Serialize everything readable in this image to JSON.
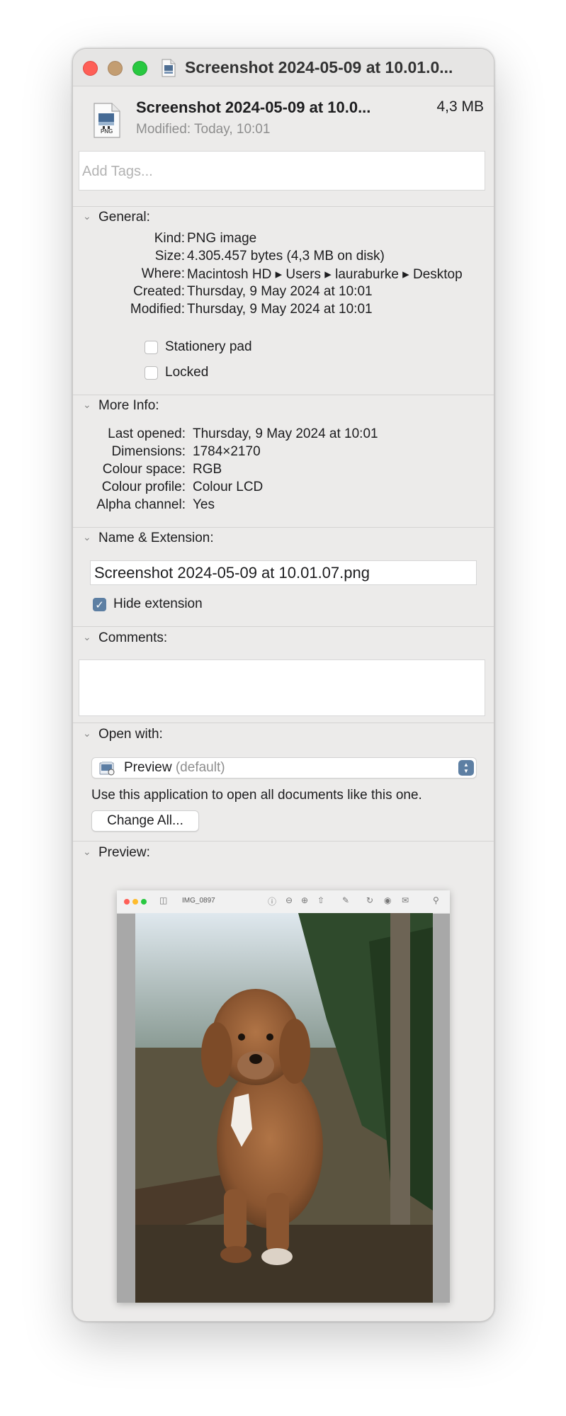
{
  "window": {
    "title": "Screenshot 2024-05-09 at 10.01.0...",
    "traffic_lights": [
      "close",
      "minimize",
      "zoom"
    ]
  },
  "header": {
    "file_name": "Screenshot 2024-05-09 at 10.0...",
    "file_size": "4,3 MB",
    "modified": "Modified: Today, 10:01",
    "file_icon": "png-file-icon",
    "file_icon_badge": "PNG"
  },
  "tags": {
    "placeholder": "Add Tags..."
  },
  "general": {
    "heading": "General:",
    "rows": [
      {
        "label": "Kind:",
        "value": "PNG image"
      },
      {
        "label": "Size:",
        "value": "4.305.457 bytes (4,3 MB on disk)"
      },
      {
        "label": "Where:",
        "value": "Macintosh HD ▸ Users ▸ lauraburke ▸ Desktop"
      },
      {
        "label": "Created:",
        "value": "Thursday, 9 May 2024 at 10:01"
      },
      {
        "label": "Modified:",
        "value": "Thursday, 9 May 2024 at 10:01"
      }
    ],
    "stationery_label": "Stationery pad",
    "locked_label": "Locked"
  },
  "more_info": {
    "heading": "More Info:",
    "rows": [
      {
        "label": "Last opened:",
        "value": "Thursday, 9 May 2024 at 10:01"
      },
      {
        "label": "Dimensions:",
        "value": "1784×2170"
      },
      {
        "label": "Colour space:",
        "value": "RGB"
      },
      {
        "label": "Colour profile:",
        "value": "Colour LCD"
      },
      {
        "label": "Alpha channel:",
        "value": "Yes"
      }
    ]
  },
  "name_extension": {
    "heading": "Name & Extension:",
    "value": "Screenshot 2024-05-09 at 10.01.07.png",
    "hide_extension_label": "Hide extension",
    "hide_extension_checked": true
  },
  "comments": {
    "heading": "Comments:"
  },
  "open_with": {
    "heading": "Open with:",
    "app": "Preview",
    "app_suffix": " (default)",
    "description": "Use this application to open all documents like this one.",
    "change_all": "Change All..."
  },
  "preview": {
    "heading": "Preview:",
    "inner_title": "IMG_0897"
  },
  "colors": {
    "window_bg": "#ecebea",
    "accent": "#5d7fa3",
    "close": "#fe5f57",
    "minimize": "#c39d71",
    "zoom": "#28c840"
  }
}
